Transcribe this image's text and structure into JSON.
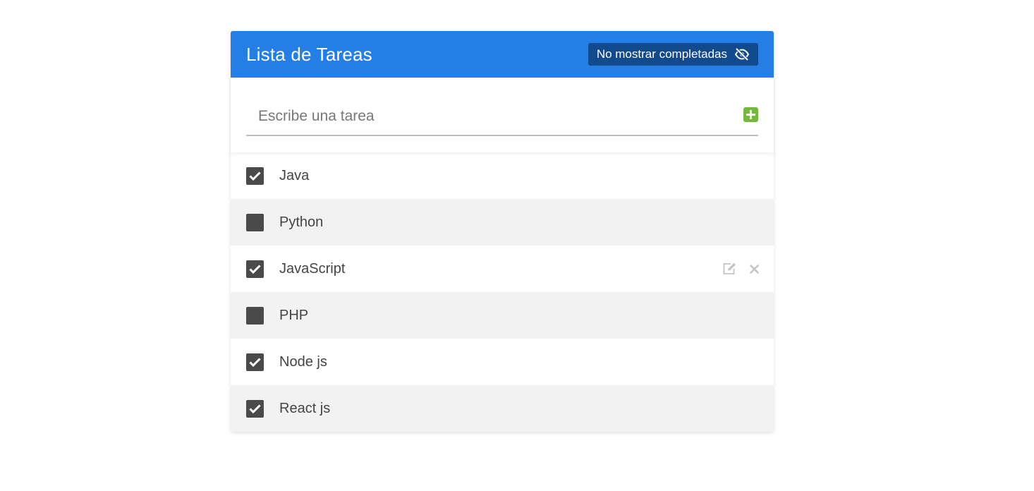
{
  "header": {
    "title": "Lista de Tareas",
    "toggle_label": "No mostrar completadas",
    "toggle_icon": "eye-slash-icon",
    "color": "#257ee6",
    "button_color": "#124a8e"
  },
  "form": {
    "placeholder": "Escribe una tarea",
    "value": "",
    "add_icon": "plus-square-icon",
    "add_color": "#75b840"
  },
  "tasks": [
    {
      "label": "Java",
      "completed": true
    },
    {
      "label": "Python",
      "completed": false
    },
    {
      "label": "JavaScript",
      "completed": true,
      "hovered": true,
      "actions": [
        "edit-icon",
        "close-icon"
      ]
    },
    {
      "label": "PHP",
      "completed": false
    },
    {
      "label": "Node js",
      "completed": true
    },
    {
      "label": "React js",
      "completed": true
    }
  ]
}
